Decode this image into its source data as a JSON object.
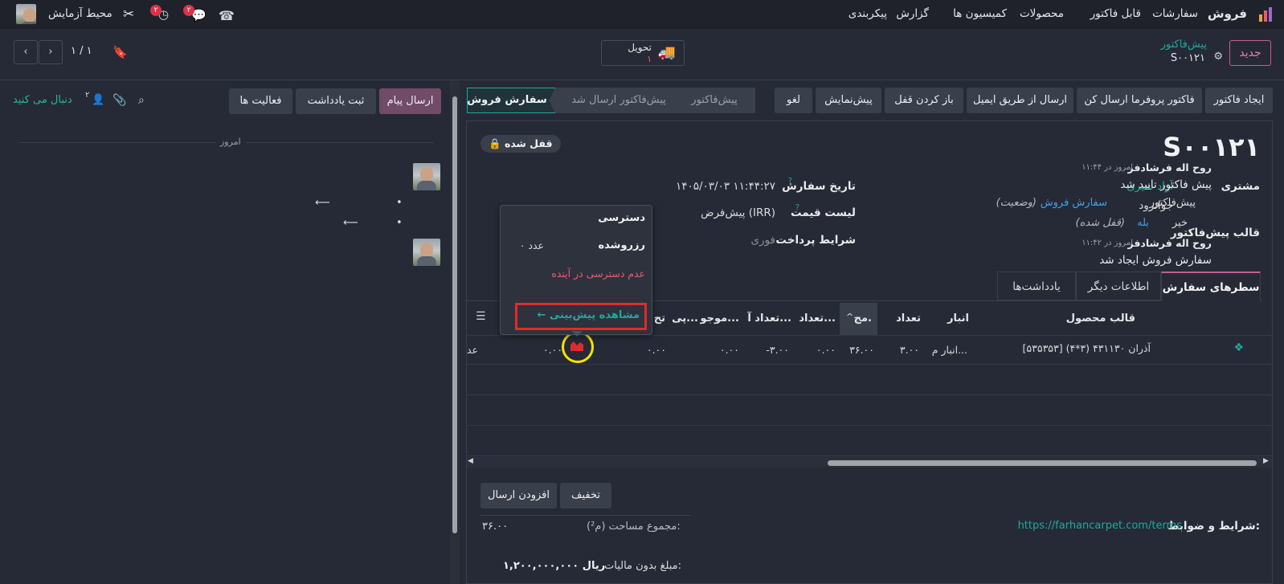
{
  "topnav": {
    "app_name": "فروش",
    "menu": [
      "سفارشات",
      "قابل فاکتور",
      "محصولات",
      "کمیسیون ها",
      "گزارش",
      "پیکربندی"
    ],
    "company": "محیط آزمایش",
    "chat_badge": "۲",
    "activity_badge": "۲"
  },
  "control": {
    "breadcrumb_parent": "پیش‌فاکتور",
    "record_name": "S۰۰۱۲۱",
    "new_btn": "جدید",
    "pager": "۱ / ۱",
    "delivery_label": "تحویل",
    "delivery_count": "۱"
  },
  "actions": [
    "ایجاد فاکتور",
    "فاکتور پروفرما ارسال کن",
    "ارسال از طریق ایمیل",
    "باز کردن قفل",
    "پیش‌نمایش",
    "لغو"
  ],
  "statusbar": [
    "پیش‌فاکتور",
    "پیش‌فاکتور ارسال شد",
    "سفارش فروش"
  ],
  "form": {
    "title": "S۰۰۱۲۱",
    "locked": "قفل شده",
    "customer_label": "مشتری",
    "customer_name": "آزاد شیری",
    "customer_city": "جوانرود",
    "template_label": "قالب پیش‌فاکتور",
    "order_date_label": "تاریخ سفارش",
    "order_date": "۱۴۰۵/۰۳/۰۳ ۱۱:۴۴:۲۷",
    "pricelist_label": "لیست قیمت",
    "pricelist": "پیش‌فرض (IRR)",
    "payment_label": "شرایط پرداخت",
    "payment": "فوری"
  },
  "tabs": [
    "سطرهای سفارش",
    "اطلاعات دیگر",
    "یادداشت‌ها"
  ],
  "columns": [
    "قالب محصول",
    "انبار",
    "تعداد",
    "مج.",
    "تعداد...",
    "تعداد آ...",
    "موجو...",
    "پی...",
    "تح"
  ],
  "row": {
    "product": "[۵۳۵۳۵۳] آذران ۴۳۱۱۳۰ (۳*۴)",
    "warehouse": "انبار م...",
    "qty": "۳.۰۰",
    "area": "۳۶.۰۰",
    "c1": "۰.۰۰",
    "c2": "-۳.۰۰",
    "c3": "۰.۰۰",
    "c4": "۰.۰۰",
    "c5": "۰.۰۰",
    "c6": "عد"
  },
  "popover": {
    "title": "دسترسی",
    "reserved_label": "رزروشده",
    "reserved_value": "۰ عدد",
    "unavailable": "عدم دسترسی در آینده",
    "forecast_link": "مشاهده پیش‌بینی"
  },
  "footer": {
    "discount_btn": "تخفیف",
    "add_shipping_btn": "افزودن ارسال",
    "terms_label": "شرایط و ضوابط:",
    "terms_url": "https://farhancarpet.com/terms",
    "area_label": "مجموع مساحت (م²):",
    "area_value": "۳۶.۰۰",
    "untaxed_label": "مبلغ بدون مالیات:",
    "untaxed_value": "۱,۲۰۰,۰۰۰,۰۰۰ ریال"
  },
  "chatter": {
    "send_message": "ارسال پیام",
    "log_note": "ثبت یادداشت",
    "activities": "فعالیت ها",
    "follow": "دنبال می کنید",
    "followers_count": "۲",
    "today": "امروز",
    "messages": [
      {
        "author": "روح اله فرشادفر",
        "time": "امروز در ۱۱:۴۴",
        "body": "پیش فاکتور تایید شد",
        "changes": [
          {
            "old": "پیش‌فاکتور",
            "new": "سفارش فروش",
            "field": "(وضعیت)"
          },
          {
            "old": "خیر",
            "new": "بله",
            "field": "(قفل شده)"
          }
        ]
      },
      {
        "author": "روح اله فرشادفر",
        "time": "امروز در ۱۱:۴۲",
        "body": "سفارش فروش ایجاد شد"
      }
    ]
  },
  "colors": {
    "accent": "#1fa99c",
    "brand": "#714b67",
    "badge": "#d9334a",
    "highlight": "#e02b2b",
    "circle": "#f5e400"
  }
}
